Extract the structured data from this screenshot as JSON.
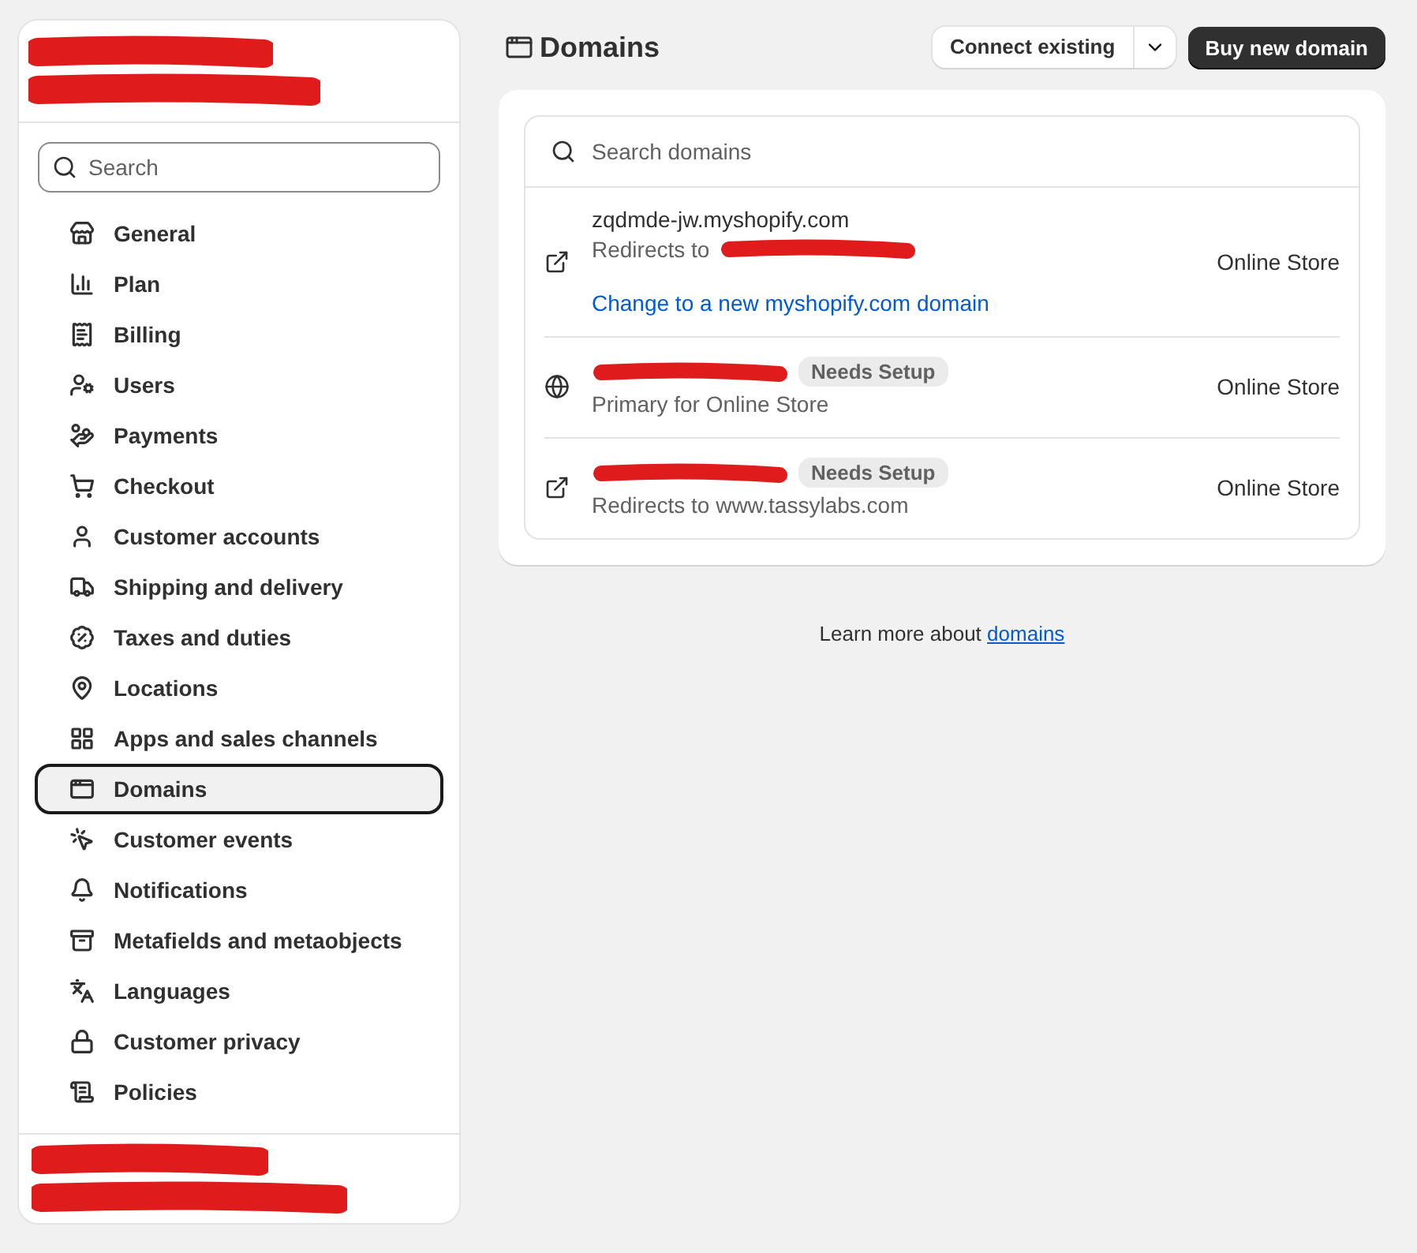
{
  "sidebar": {
    "header_redacted": true,
    "search": {
      "placeholder": "Search"
    },
    "items": [
      {
        "label": "General",
        "selected": false
      },
      {
        "label": "Plan",
        "selected": false
      },
      {
        "label": "Billing",
        "selected": false
      },
      {
        "label": "Users",
        "selected": false
      },
      {
        "label": "Payments",
        "selected": false
      },
      {
        "label": "Checkout",
        "selected": false
      },
      {
        "label": "Customer accounts",
        "selected": false
      },
      {
        "label": "Shipping and delivery",
        "selected": false
      },
      {
        "label": "Taxes and duties",
        "selected": false
      },
      {
        "label": "Locations",
        "selected": false
      },
      {
        "label": "Apps and sales channels",
        "selected": false
      },
      {
        "label": "Domains",
        "selected": true
      },
      {
        "label": "Customer events",
        "selected": false
      },
      {
        "label": "Notifications",
        "selected": false
      },
      {
        "label": "Metafields and metaobjects",
        "selected": false
      },
      {
        "label": "Languages",
        "selected": false
      },
      {
        "label": "Customer privacy",
        "selected": false
      },
      {
        "label": "Policies",
        "selected": false
      }
    ],
    "footer_redacted": true
  },
  "page": {
    "title": "Domains",
    "buttons": [
      {
        "label": "Connect existing",
        "kind": "split"
      },
      {
        "label": "Buy new domain",
        "kind": "primary"
      }
    ]
  },
  "domains": {
    "search": {
      "placeholder": "Search domains"
    },
    "rows": [
      {
        "kind": "redirect",
        "name": "zqdmde-jw.myshopify.com",
        "note": "Redirects to",
        "note_redacted": true,
        "link": "Change to a new myshopify.com domain",
        "channel": "Online Store"
      },
      {
        "kind": "primary",
        "name_redacted": true,
        "badge": "Needs Setup",
        "note": "Primary for Online Store",
        "channel": "Online Store"
      },
      {
        "kind": "redirect",
        "name_redacted": true,
        "badge": "Needs Setup",
        "note": "Redirects to www.tassylabs.com",
        "channel": "Online Store"
      }
    ]
  },
  "footer": {
    "text": "Learn more about",
    "link": "domains"
  }
}
